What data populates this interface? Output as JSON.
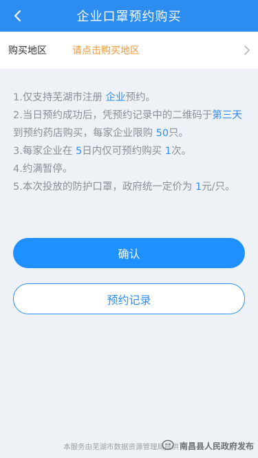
{
  "header": {
    "title": "企业口罩预约购买"
  },
  "region": {
    "label": "购买地区",
    "placeholder": "请点击购买地区"
  },
  "notes": {
    "n1_a": "1.仅支持芜湖市注册 ",
    "n1_b": "企业",
    "n1_c": "预约。",
    "n2_a": "2.当日预约成功后，凭预约记录中的二维码于",
    "n2_b": "第三天",
    "n2_c": "到预约药店购买，每家企业限购 ",
    "n2_d": "50",
    "n2_e": "只。",
    "n3_a": "3.每家企业在 ",
    "n3_b": "5",
    "n3_c": "日内仅可预约购买 ",
    "n3_d": "1",
    "n3_e": "次。",
    "n4": "4.约满暂停。",
    "n5_a": "5.本次投放的防护口罩，政府统一定价为 ",
    "n5_b": "1",
    "n5_c": "元/只。"
  },
  "buttons": {
    "confirm": "确认",
    "records": "预约记录"
  },
  "footer": {
    "text": "本服务由芜湖市数据资源管理局提供",
    "watermark": "南昌县人民政府发布"
  },
  "colors": {
    "primary": "#2d8cf0",
    "accent_orange": "#ef9a3a"
  }
}
